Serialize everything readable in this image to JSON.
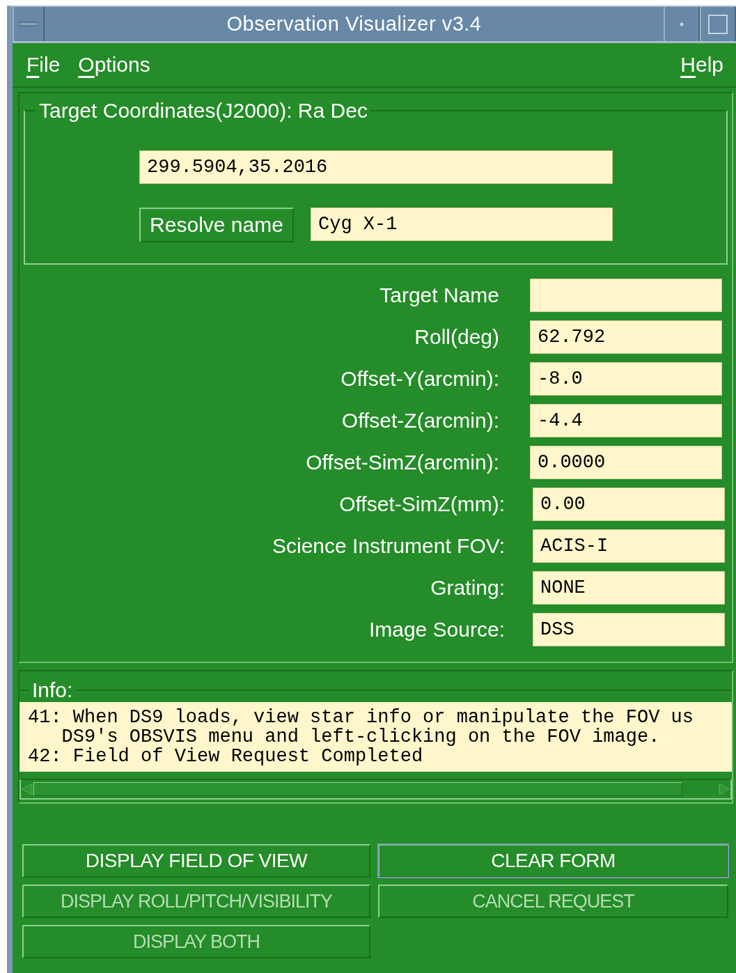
{
  "window": {
    "title": "Observation Visualizer v3.4"
  },
  "menu": {
    "left": [
      {
        "label": "File"
      },
      {
        "label": "Options"
      }
    ],
    "right": [
      {
        "label": "Help"
      }
    ]
  },
  "coordinates": {
    "legend": "Target Coordinates(J2000): Ra Dec",
    "value": "299.5904,35.2016",
    "resolve_button": "Resolve name",
    "name_value": "Cyg X-1"
  },
  "fields": [
    {
      "label": "Target Name",
      "kind": "entry"
    },
    {
      "label": "Roll(deg)",
      "value": "62.792",
      "kind": "entry"
    },
    {
      "label": "Offset-Y(arcmin):",
      "value": "-8.0",
      "kind": "entry"
    },
    {
      "label": "Offset-Z(arcmin):",
      "value": "-4.4",
      "kind": "entry"
    },
    {
      "label": "Offset-SimZ(arcmin):",
      "value": "0.0000",
      "kind": "entry"
    },
    {
      "label": "Offset-SimZ(mm):",
      "value": "0.00",
      "kind": "display"
    },
    {
      "label": "Science Instrument FOV:",
      "value": "ACIS-I",
      "kind": "display"
    },
    {
      "label": "Grating:",
      "value": "NONE",
      "kind": "display"
    },
    {
      "label": "Image Source:",
      "value": "DSS",
      "kind": "display"
    }
  ],
  "info": {
    "legend": "Info:",
    "lines": [
      "41: When DS9 loads, view star info or manipulate the FOV us",
      "   DS9's OBSVIS menu and left-clicking on the FOV image.",
      "42: Field of View Request Completed"
    ]
  },
  "buttons": [
    {
      "label": "DISPLAY FIELD OF VIEW",
      "disabled": false,
      "focused": false
    },
    {
      "label": "CLEAR FORM",
      "disabled": false,
      "focused": true
    },
    {
      "label": "DISPLAY ROLL/PITCH/VISIBILITY",
      "disabled": true,
      "focused": false
    },
    {
      "label": "CANCEL REQUEST",
      "disabled": true,
      "focused": false
    },
    {
      "label": "DISPLAY BOTH",
      "disabled": true,
      "focused": false
    }
  ]
}
